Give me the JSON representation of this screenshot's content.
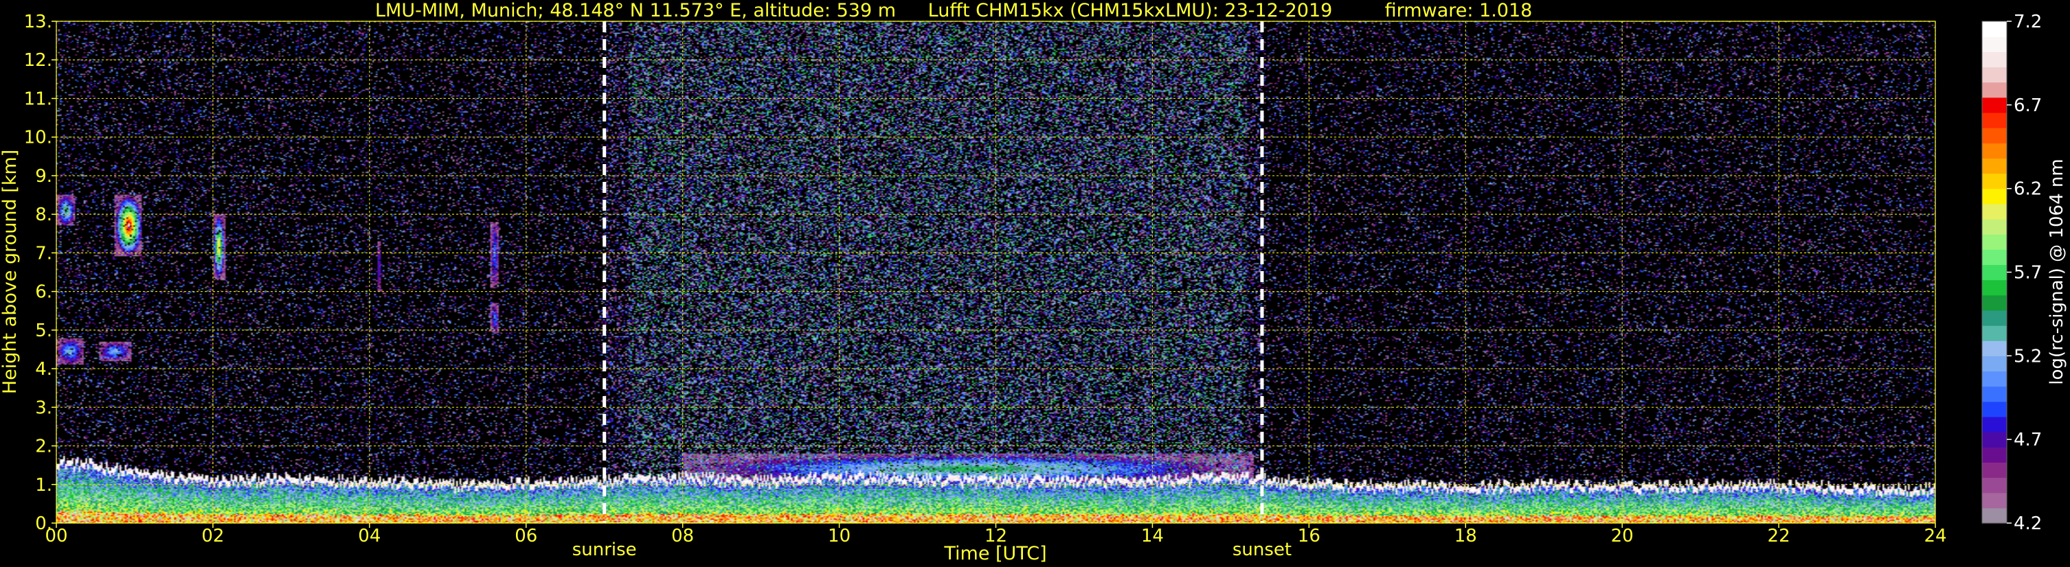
{
  "chart_data": {
    "type": "heatmap",
    "title": "LMU-MIM, Munich; 48.148° N 11.573° E, altitude: 539 m",
    "subtitle": "Lufft CHM15kx (CHM15kxLMU): 23-12-2019",
    "firmware": "firmware: 1.018",
    "xlabel": "Time [UTC]",
    "ylabel": "Height above ground [km]",
    "xlim": [
      0,
      24
    ],
    "ylim": [
      0,
      13
    ],
    "x_ticks": [
      "00",
      "02",
      "04",
      "06",
      "08",
      "10",
      "12",
      "14",
      "16",
      "18",
      "20",
      "22",
      "24"
    ],
    "y_ticks": [
      "0.",
      "1.",
      "2.",
      "3.",
      "4.",
      "5.",
      "6.",
      "7.",
      "8.",
      "9.",
      "10.",
      "11.",
      "12.",
      "13."
    ],
    "grid": true,
    "colorbar": {
      "label": "log(rc-signal) @ 1064 nm",
      "range": [
        4.2,
        7.2
      ],
      "ticks": [
        "4.2",
        "4.7",
        "5.2",
        "5.7",
        "6.2",
        "6.7",
        "7.2"
      ],
      "colors": [
        "#9c8ea3",
        "#a6669e",
        "#9a4a94",
        "#8a2a88",
        "#6a0e90",
        "#4a0aa8",
        "#2a10d6",
        "#1e44ff",
        "#3a72ff",
        "#5c92ff",
        "#7aaaf2",
        "#98bcf0",
        "#56b8a8",
        "#2a9a80",
        "#169a3a",
        "#1cc23a",
        "#3ede62",
        "#6ef07a",
        "#98f47a",
        "#c4f07a",
        "#e6f060",
        "#fff200",
        "#ffd000",
        "#ffa800",
        "#ff8400",
        "#ff5800",
        "#ff2e00",
        "#f00000",
        "#e6a0a0",
        "#f0cece",
        "#f6e6e6",
        "#fbf6f6",
        "#ffffff"
      ]
    },
    "annotations": [
      {
        "label": "sunrise",
        "x": 7.0
      },
      {
        "label": "sunset",
        "x": 15.4
      }
    ],
    "boundary_layer_top_km": [
      [
        0.0,
        1.5
      ],
      [
        0.5,
        1.4
      ],
      [
        1.0,
        1.2
      ],
      [
        2.0,
        1.0
      ],
      [
        3.0,
        1.05
      ],
      [
        4.0,
        1.0
      ],
      [
        5.0,
        0.9
      ],
      [
        6.0,
        0.95
      ],
      [
        7.0,
        1.0
      ],
      [
        8.0,
        1.1
      ],
      [
        9.0,
        1.0
      ],
      [
        10.0,
        1.1
      ],
      [
        11.0,
        1.05
      ],
      [
        12.0,
        1.0
      ],
      [
        13.0,
        1.0
      ],
      [
        14.0,
        1.0
      ],
      [
        15.0,
        1.1
      ],
      [
        16.0,
        0.95
      ],
      [
        17.0,
        0.85
      ],
      [
        18.0,
        0.85
      ],
      [
        19.0,
        0.9
      ],
      [
        20.0,
        0.85
      ],
      [
        21.0,
        0.9
      ],
      [
        22.0,
        0.9
      ],
      [
        23.0,
        0.8
      ],
      [
        24.0,
        0.8
      ]
    ],
    "high_features": [
      {
        "t0": 0.0,
        "t1": 0.25,
        "h0": 7.7,
        "h1": 8.5,
        "peak": 5.6
      },
      {
        "t0": 0.75,
        "t1": 1.1,
        "h0": 6.9,
        "h1": 8.5,
        "peak": 7.0
      },
      {
        "t0": 2.0,
        "t1": 2.15,
        "h0": 6.3,
        "h1": 8.0,
        "peak": 6.4
      },
      {
        "t0": 0.0,
        "t1": 0.35,
        "h0": 4.1,
        "h1": 4.8,
        "peak": 5.3
      },
      {
        "t0": 0.55,
        "t1": 0.95,
        "h0": 4.2,
        "h1": 4.7,
        "peak": 5.3
      },
      {
        "t0": 4.1,
        "t1": 4.15,
        "h0": 6.0,
        "h1": 7.3,
        "peak": 5.0
      },
      {
        "t0": 5.55,
        "t1": 5.65,
        "h0": 6.1,
        "h1": 7.8,
        "peak": 5.1
      },
      {
        "t0": 5.55,
        "t1": 5.65,
        "h0": 4.9,
        "h1": 5.7,
        "peak": 5.1
      },
      {
        "t0": 8.0,
        "t1": 15.3,
        "h0": 1.0,
        "h1": 1.8,
        "peak": 5.6
      }
    ]
  }
}
